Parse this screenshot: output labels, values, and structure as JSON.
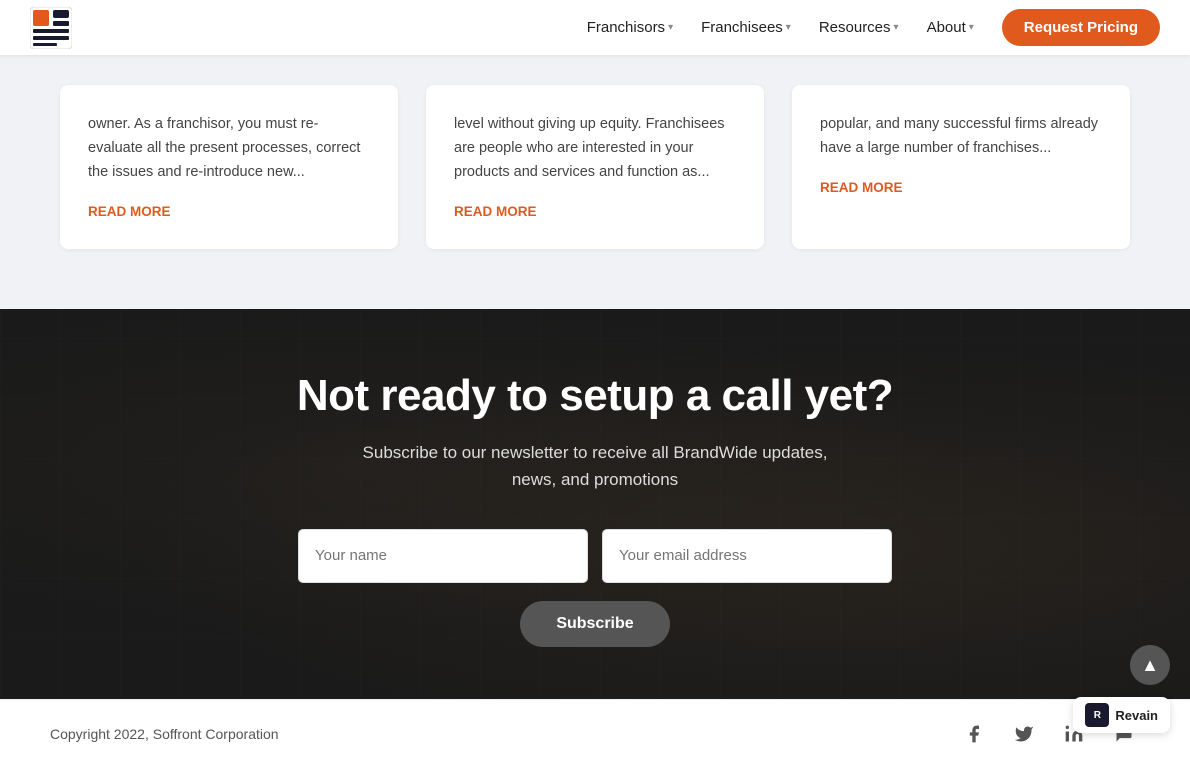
{
  "header": {
    "logo_alt": "BrandWide Logo",
    "nav": [
      {
        "label": "Franchisors",
        "has_dropdown": true
      },
      {
        "label": "Franchisees",
        "has_dropdown": true
      },
      {
        "label": "Resources",
        "has_dropdown": true
      },
      {
        "label": "About",
        "has_dropdown": true
      }
    ],
    "cta_label": "Request Pricing"
  },
  "cards": [
    {
      "text": "owner. As a franchisor, you must re-evaluate all the present processes, correct the issues and re-introduce new...",
      "read_more": "READ MORE"
    },
    {
      "text": "level without giving up equity. Franchisees are people who are interested in your products and services and function as...",
      "read_more": "READ MORE"
    },
    {
      "text": "popular, and many successful firms already have a large number of franchises...",
      "read_more": "READ MORE"
    }
  ],
  "cta": {
    "title": "Not ready to setup a call yet?",
    "subtitle": "Subscribe to our newsletter to receive all BrandWide updates,\nnews, and promotions",
    "name_placeholder": "Your name",
    "email_placeholder": "Your email address",
    "subscribe_label": "Subscribe"
  },
  "footer": {
    "copyright": "Copyright 2022, Soffront Corporation",
    "socials": [
      {
        "name": "facebook-icon",
        "symbol": "f"
      },
      {
        "name": "twitter-icon",
        "symbol": "t"
      },
      {
        "name": "linkedin-icon",
        "symbol": "in"
      },
      {
        "name": "chat-icon",
        "symbol": "💬"
      }
    ]
  },
  "revain": {
    "label": "Revain"
  },
  "scroll_top": "▲"
}
